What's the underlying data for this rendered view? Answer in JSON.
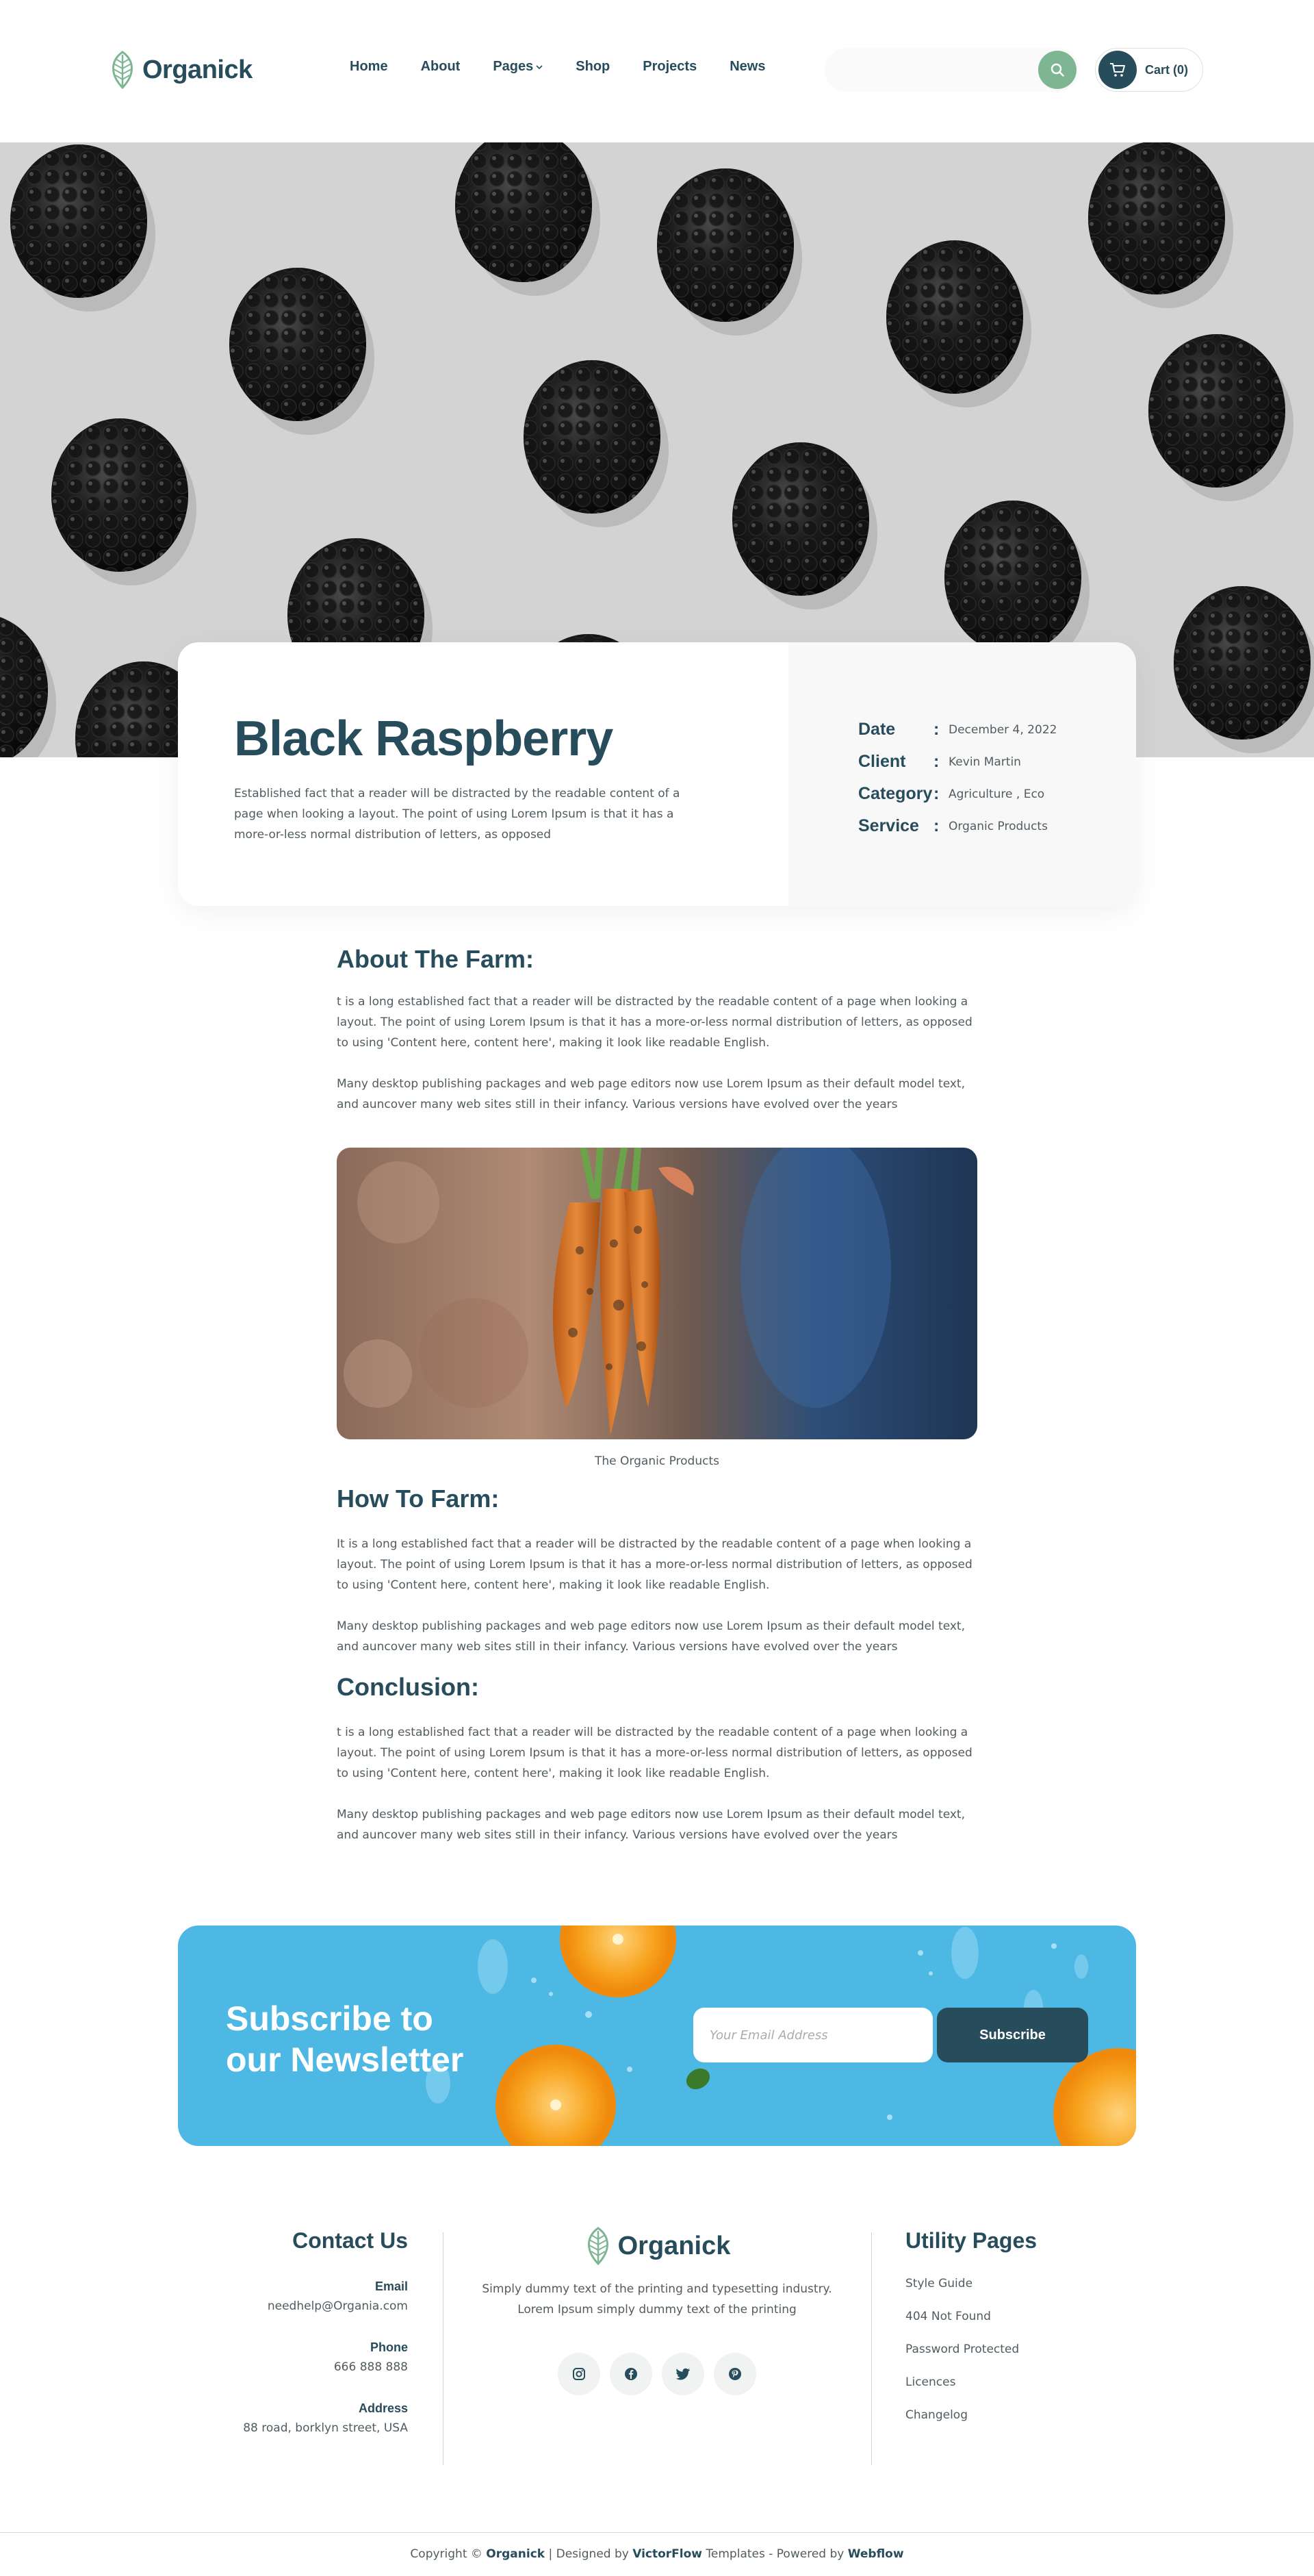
{
  "colors": {
    "primary": "#274C5B",
    "accent_green": "#7EB693",
    "newsletter_blue": "#4CB8E3",
    "body_text": "#525C60",
    "orange": "#F7931E"
  },
  "header": {
    "logo_text": "Organick",
    "nav": [
      {
        "label": "Home"
      },
      {
        "label": "About"
      },
      {
        "label": "Pages",
        "has_dropdown": true
      },
      {
        "label": "Shop"
      },
      {
        "label": "Projects"
      },
      {
        "label": "News"
      }
    ],
    "search": {
      "placeholder": "",
      "icon": "search-icon"
    },
    "cart_label": "Cart (0)"
  },
  "hero": {
    "image": "blackberries-pattern"
  },
  "title_card": {
    "title": "Black Raspberry",
    "description": "Established fact that a reader will be distracted by the readable content of a page when looking a layout. The point of using Lorem Ipsum is that it has a more-or-less normal distribution of letters, as opposed",
    "meta": [
      {
        "key": "Date",
        "value": "December 4, 2022"
      },
      {
        "key": "Client",
        "value": "Kevin Martin"
      },
      {
        "key": "Category",
        "value": "Agriculture , Eco"
      },
      {
        "key": "Service",
        "value": "Organic Products"
      }
    ]
  },
  "article": {
    "about_heading": "About The Farm:",
    "about_p1": "t is a long established fact that a reader will be distracted by the readable content of a page when looking a layout. The point of using Lorem Ipsum is that it has a more-or-less normal distribution of letters, as opposed to using 'Content here, content here', making it look like readable English.",
    "about_p2": "Many desktop publishing packages and web page editors now use Lorem Ipsum as their default model text, and auncover many web sites still in their infancy. Various versions have evolved over the years",
    "image_caption": "The Organic Products",
    "how_heading": "How To Farm:",
    "how_p1": "It is a long established fact that a reader will be distracted by the readable content of a page when looking a layout. The point of using Lorem Ipsum is that it has a more-or-less normal distribution of letters, as opposed to using 'Content here, content here', making it look like readable English.",
    "how_p2": "Many desktop publishing packages and web page editors now use Lorem Ipsum as their default model text, and auncover many web sites still in their infancy. Various versions have evolved over the years",
    "conclusion_heading": "Conclusion:",
    "conclusion_p1": "t is a long established fact that a reader will be distracted by the readable content of a page when looking a layout. The point of using Lorem Ipsum is that it has a more-or-less normal distribution of letters, as opposed to using 'Content here, content here', making it look like readable English.",
    "conclusion_p2": "Many desktop publishing packages and web page editors now use Lorem Ipsum as their default model text, and auncover many web sites still in their infancy. Various versions have evolved over the years"
  },
  "newsletter": {
    "title_line1": "Subscribe to",
    "title_line2": "our Newsletter",
    "email_placeholder": "Your Email Address",
    "button_label": "Subscribe"
  },
  "footer": {
    "contact": {
      "heading": "Contact Us",
      "email_label": "Email",
      "email_value": "needhelp@Organia.com",
      "phone_label": "Phone",
      "phone_value": "666 888 888",
      "address_label": "Address",
      "address_value": "88 road, borklyn street, USA"
    },
    "center": {
      "logo_text": "Organick",
      "description": "Simply dummy text of the printing and typesetting industry. Lorem Ipsum simply dummy text of the printing",
      "socials": [
        "instagram-icon",
        "facebook-icon",
        "twitter-icon",
        "pinterest-icon"
      ]
    },
    "utility": {
      "heading": "Utility Pages",
      "links": [
        "Style Guide",
        "404 Not Found",
        "Password Protected",
        "Licences",
        "Changelog"
      ]
    },
    "copyright": {
      "prefix": "Copyright © ",
      "brand": "Organick",
      "designed_by": " | Designed by ",
      "designer": "VictorFlow",
      "powered": " Templates - Powered by ",
      "platform": "Webflow"
    }
  }
}
